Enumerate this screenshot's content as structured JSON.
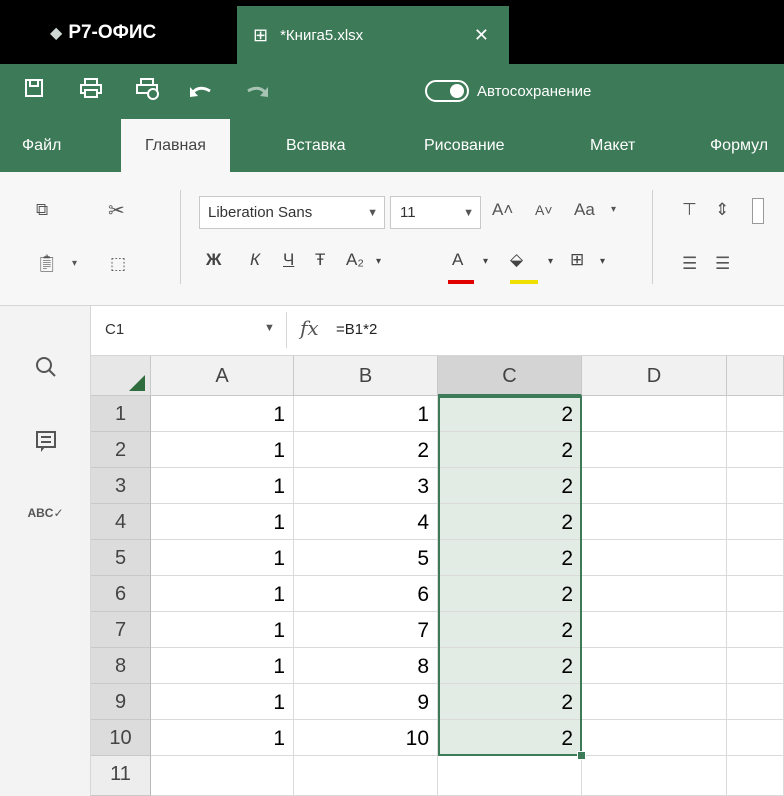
{
  "app": {
    "brand": "Р7-ОФИС",
    "document_tab": "*Книга5.xlsx"
  },
  "quick_toolbar": {
    "autosave_label": "Автосохранение"
  },
  "menu": {
    "tabs": [
      "Файл",
      "Главная",
      "Вставка",
      "Рисование",
      "Макет",
      "Формул"
    ],
    "active_index": 1
  },
  "ribbon": {
    "font_name": "Liberation Sans",
    "font_size": "11",
    "bold": "Ж",
    "italic": "К",
    "underline": "Ч",
    "strikethrough": "Ŧ",
    "subscript": "A₂",
    "font_color_letter": "A",
    "change_case": "Aa",
    "increase_font": "A˄",
    "decrease_font": "A˅",
    "font_color": "#e00000",
    "highlight_color": "#f0e000"
  },
  "formula_bar": {
    "cell_ref": "C1",
    "formula": "=B1*2"
  },
  "grid": {
    "columns": [
      "A",
      "B",
      "C",
      "D"
    ],
    "selected_column": "C",
    "rows": [
      {
        "num": "1",
        "a": "1",
        "b": "1",
        "c": "2"
      },
      {
        "num": "2",
        "a": "1",
        "b": "2",
        "c": "2"
      },
      {
        "num": "3",
        "a": "1",
        "b": "3",
        "c": "2"
      },
      {
        "num": "4",
        "a": "1",
        "b": "4",
        "c": "2"
      },
      {
        "num": "5",
        "a": "1",
        "b": "5",
        "c": "2"
      },
      {
        "num": "6",
        "a": "1",
        "b": "6",
        "c": "2"
      },
      {
        "num": "7",
        "a": "1",
        "b": "7",
        "c": "2"
      },
      {
        "num": "8",
        "a": "1",
        "b": "8",
        "c": "2"
      },
      {
        "num": "9",
        "a": "1",
        "b": "9",
        "c": "2"
      },
      {
        "num": "10",
        "a": "1",
        "b": "10",
        "c": "2"
      }
    ],
    "next_row": "11"
  },
  "colors": {
    "accent": "#3d7a57",
    "selection_fill": "#e3ebe5"
  }
}
